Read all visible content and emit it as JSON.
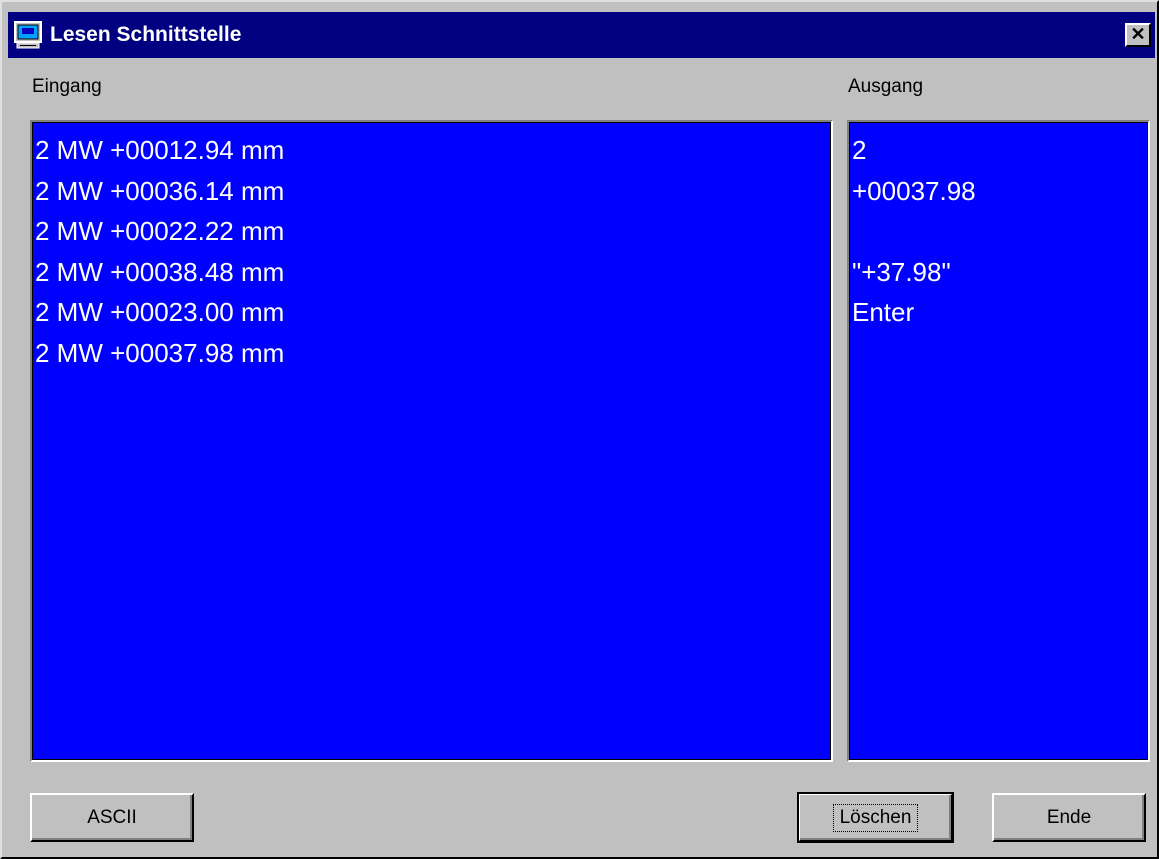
{
  "window": {
    "title": "Lesen Schnittstelle",
    "icon": "monitor-icon",
    "close_glyph": "✕"
  },
  "eingang": {
    "label": "Eingang",
    "lines": [
      "2 MW +00012.94 mm",
      "2 MW +00036.14 mm",
      "2 MW +00022.22 mm",
      "2 MW +00038.48 mm",
      "2 MW +00023.00 mm",
      "2 MW +00037.98 mm"
    ]
  },
  "ausgang": {
    "label": "Ausgang",
    "lines": [
      "2",
      "+00037.98",
      "",
      "\"+37.98\"",
      "Enter"
    ]
  },
  "buttons": {
    "ascii": "ASCII",
    "loeschen": "Löschen",
    "ende": "Ende"
  },
  "colors": {
    "titlebar": "#000080",
    "pane_background": "#0000ff",
    "pane_text": "#ffffff",
    "face": "#c0c0c0"
  }
}
